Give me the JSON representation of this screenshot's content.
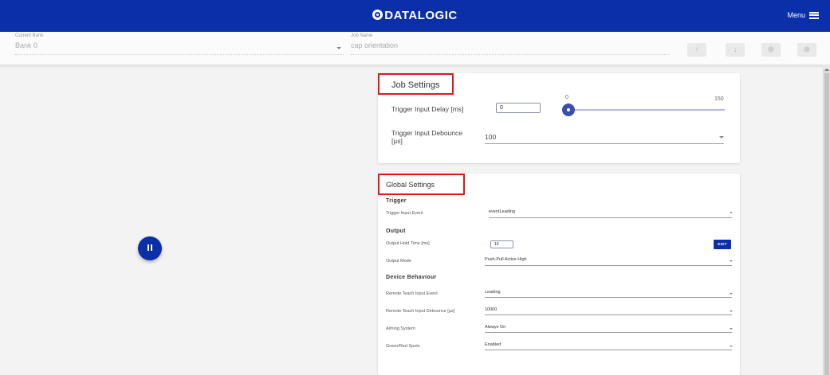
{
  "header": {
    "brand": "DATALOGIC",
    "menu_label": "Menu",
    "brand_color": "#0b2fa8"
  },
  "toolbar": {
    "bank_label": "Current Bank",
    "bank_value": "Bank 0",
    "job_label": "Job Name",
    "job_value": "cap orientation",
    "buttons": {
      "up": "↑",
      "down": "↓",
      "add": "⊕",
      "cancel": "⊗"
    }
  },
  "job_settings": {
    "title": "Job Settings",
    "trigger_delay_label": "Trigger Input Delay [ms]",
    "trigger_delay_value": "0",
    "slider_min": "0",
    "slider_max": "150",
    "slider_fraction": 0,
    "trigger_debounce_label": "Trigger Input Debounce [µs]",
    "trigger_debounce_value": "100"
  },
  "global_settings": {
    "title": "Global Settings",
    "trigger_section": "Trigger",
    "trigger_event_label": "Trigger Input Event",
    "trigger_event_value": "eventLeading",
    "output_section": "Output",
    "hold_time_label": "Output Hold Time [ms]",
    "hold_time_value": "10",
    "edit_label": "EDIT",
    "output_mode_label": "Output Mode",
    "output_mode_value": "Push-Pull Active High",
    "device_section": "Device Behaviour",
    "remote_event_label": "Remote Teach Input Event",
    "remote_event_value": "Leading",
    "remote_debounce_label": "Remote Teach Input Debounce [µs]",
    "remote_debounce_value": "10000",
    "aiming_label": "Aiming System",
    "aiming_value": "Always On",
    "spots_label": "Green/Red Spots",
    "spots_value": "Enabled"
  },
  "colors": {
    "accent": "#0b2fa8",
    "highlight": "#e01818"
  },
  "icons": [
    "datalogic-logo-icon",
    "hamburger-icon",
    "arrow-up-icon",
    "arrow-down-icon",
    "add-circle-icon",
    "cancel-circle-icon",
    "pause-icon",
    "dropdown-caret-icon"
  ]
}
